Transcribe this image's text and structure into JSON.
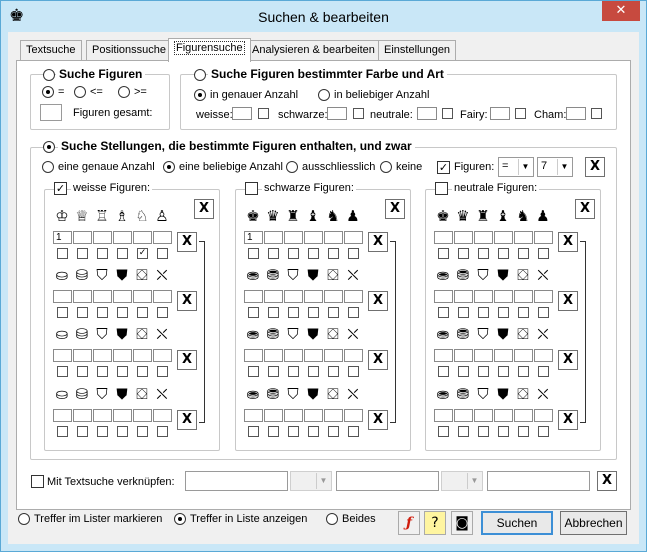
{
  "window": {
    "title": "Suchen & bearbeiten",
    "icon": "chess-king-icon",
    "close": "✕"
  },
  "tabs": [
    {
      "label": "Textsuche"
    },
    {
      "label": "Positionssuche"
    },
    {
      "label": "Figurensuche"
    },
    {
      "label": "Analysieren & bearbeiten"
    },
    {
      "label": "Einstellungen"
    }
  ],
  "suche_figuren": {
    "title": "Suche Figuren",
    "op_eq": "=",
    "op_le": "<=",
    "op_ge": ">=",
    "gesamt_label": "Figuren gesamt:"
  },
  "farbe_art": {
    "title": "Suche Figuren bestimmter Farbe und Art",
    "genau": "in genauer Anzahl",
    "beliebig": "in beliebiger Anzahl",
    "weisse": "weisse:",
    "schwarze": "schwarze:",
    "neutrale": "neutrale:",
    "fairy": "Fairy:",
    "cham": "Cham:"
  },
  "stellungen": {
    "title": "Suche Stellungen, die bestimmte Figuren enthalten, und zwar",
    "genau": "eine genaue Anzahl",
    "beliebig": "eine beliebige Anzahl",
    "ausschl": "ausschliesslich",
    "keine": "keine",
    "figuren_label": "Figuren:",
    "op": "=",
    "count": "7",
    "x": "X"
  },
  "groups": [
    {
      "label": "weisse Figuren:",
      "checked": true,
      "first": "1",
      "ticks": [
        4
      ]
    },
    {
      "label": "schwarze Figuren:",
      "checked": false,
      "first": "1",
      "ticks": []
    },
    {
      "label": "neutrale Figuren:",
      "checked": false,
      "first": "",
      "ticks": []
    }
  ],
  "piece_rows": {
    "white": [
      "♔",
      "♕",
      "♖",
      "♗",
      "♘",
      "♙"
    ],
    "black": [
      "♚",
      "♛",
      "♜",
      "♝",
      "♞",
      "♟"
    ],
    "neutral": [
      "♚",
      "♛",
      "♜",
      "♝",
      "♞",
      "♟"
    ],
    "fairy_w": [
      "⛀",
      "⛁",
      "⛉",
      "⛊",
      "⛋",
      "⛌"
    ],
    "fairy_b": [
      "⛂",
      "⛃",
      "⛉",
      "⛊",
      "⛋",
      "⛌"
    ]
  },
  "textsuche": {
    "label": "Mit Textsuche verknüpfen:"
  },
  "bottom": {
    "markieren": "Treffer im Lister markieren",
    "anzeigen": "Treffer in Liste anzeigen",
    "beides": "Beides",
    "suchen": "Suchen",
    "abbrechen": "Abbrechen"
  },
  "colors": {
    "titlebar": "#c9e7f7",
    "close": "#c74a3f",
    "default_btn": "#3c8fd6"
  }
}
